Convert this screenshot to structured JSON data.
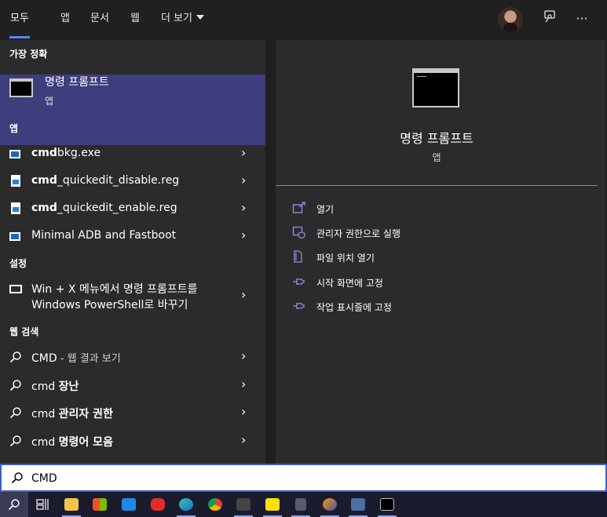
{
  "tabs": [
    {
      "label": "모두"
    },
    {
      "label": "앱"
    },
    {
      "label": "문서"
    },
    {
      "label": "웹"
    },
    {
      "label": "더 보기"
    }
  ],
  "icons": {
    "feedback": "feedback-icon",
    "more": "more-options-icon"
  },
  "best_match": {
    "header": "가장 정확",
    "title": "명령 프롬프트",
    "subtitle": "앱"
  },
  "apps": {
    "header": "앱",
    "items": [
      {
        "bold": "cmd",
        "rest": "bkg.exe"
      },
      {
        "bold": "cmd",
        "rest": "_quickedit_disable.reg"
      },
      {
        "bold": "cmd",
        "rest": "_quickedit_enable.reg"
      },
      {
        "bold": "",
        "rest": "Minimal ADB and Fastboot"
      }
    ]
  },
  "settings": {
    "header": "설정",
    "item_line1": "Win + X 메뉴에서 명령 프롬프트를",
    "item_line2": "Windows PowerShell로 바꾸기"
  },
  "web": {
    "header": "웹 검색",
    "items": [
      {
        "plain": "CMD",
        "muted": " - 웹 결과 보기",
        "bold": ""
      },
      {
        "plain": "cmd ",
        "muted": "",
        "bold": "장난"
      },
      {
        "plain": "cmd ",
        "muted": "",
        "bold": "관리자 권한"
      },
      {
        "plain": "cmd ",
        "muted": "",
        "bold": "명령어 모음"
      }
    ]
  },
  "detail": {
    "title": "명령 프롬프트",
    "subtitle": "앱",
    "actions": [
      {
        "label": "열기",
        "icon": "open-icon"
      },
      {
        "label": "관리자 권한으로 실행",
        "icon": "shield-run-icon"
      },
      {
        "label": "파일 위치 열기",
        "icon": "file-location-icon"
      },
      {
        "label": "시작 화면에 고정",
        "icon": "pin-icon"
      },
      {
        "label": "작업 표시줄에 고정",
        "icon": "pin-icon"
      }
    ]
  },
  "search": {
    "value": "CMD"
  },
  "taskbar": {
    "apps": [
      "search-icon",
      "task-view-icon",
      "file-explorer-icon",
      "store-icon",
      "mail-icon",
      "youtube-icon",
      "edge-icon",
      "chrome-icon",
      "game-icon",
      "kakaotalk-icon",
      "calculator-icon",
      "paint-icon",
      "network-icon",
      "terminal-icon"
    ]
  },
  "colors": {
    "accent": "#5b84f5",
    "selection": "#3e3d7e",
    "action_icon": "#8f8fe8"
  }
}
